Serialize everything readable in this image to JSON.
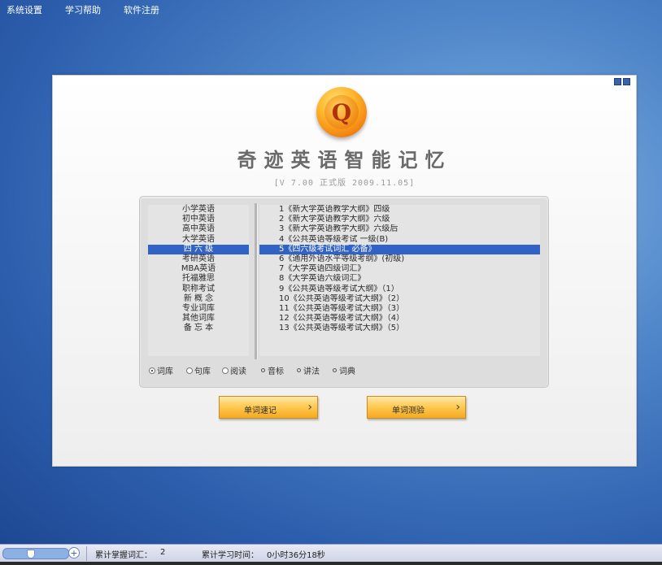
{
  "menu": [
    "系统设置",
    "学习帮助",
    "软件注册"
  ],
  "app": {
    "title": "奇迹英语智能记忆",
    "version": "[V 7.00  正式版  2009.11.05]",
    "logo_letter": "Q"
  },
  "categories": [
    {
      "label": "小学英语"
    },
    {
      "label": "初中英语"
    },
    {
      "label": "高中英语"
    },
    {
      "label": "大学英语"
    },
    {
      "label": "四 六 级",
      "selected": true
    },
    {
      "label": "考研英语"
    },
    {
      "label": "MBA英语"
    },
    {
      "label": "托福雅思"
    },
    {
      "label": "职称考试"
    },
    {
      "label": "新 概 念"
    },
    {
      "label": "专业词库"
    },
    {
      "label": "其他词库"
    },
    {
      "label": "备 忘 本"
    }
  ],
  "books": [
    {
      "label": "1《新大学英语教学大纲》四级"
    },
    {
      "label": "2《新大学英语教学大纲》六级"
    },
    {
      "label": "3《新大学英语教学大纲》六级后"
    },
    {
      "label": "4《公共英语等级考试 一级(B)"
    },
    {
      "label": "5《四六级考试词汇 必备》",
      "selected": true
    },
    {
      "label": "6《通用外语水平等级考纲》(初级)"
    },
    {
      "label": "7《大学英语四级词汇》"
    },
    {
      "label": "8《大学英语六级词汇》"
    },
    {
      "label": "9《公共英语等级考试大纲》（1）"
    },
    {
      "label": "10《公共英语等级考试大纲》（2）"
    },
    {
      "label": "11《公共英语等级考试大纲》（3）"
    },
    {
      "label": "12《公共英语等级考试大纲》（4）"
    },
    {
      "label": "13《公共英语等级考试大纲》（5）"
    }
  ],
  "options": {
    "mode_ciku": "词库",
    "mode_juku": "句库",
    "mode_yuedu": "阅读",
    "opt_yinbiao": "音标",
    "opt_jiangfa": "讲法",
    "opt_cidian": "词典",
    "selected_mode": "词库"
  },
  "buttons": {
    "speed_memorize": "单词速记",
    "word_test": "单词测验",
    "arrow": "›"
  },
  "status": {
    "mastered_label": "累计掌握词汇：",
    "mastered_value": "2",
    "time_label": "累计学习时间：",
    "time_value": "0小时36分18秒",
    "zoom_plus": "+"
  },
  "colors": {
    "selection": "#3163c6",
    "button_gradient_mid": "#ffcb55",
    "desktop_blue": "#4f86c9"
  }
}
